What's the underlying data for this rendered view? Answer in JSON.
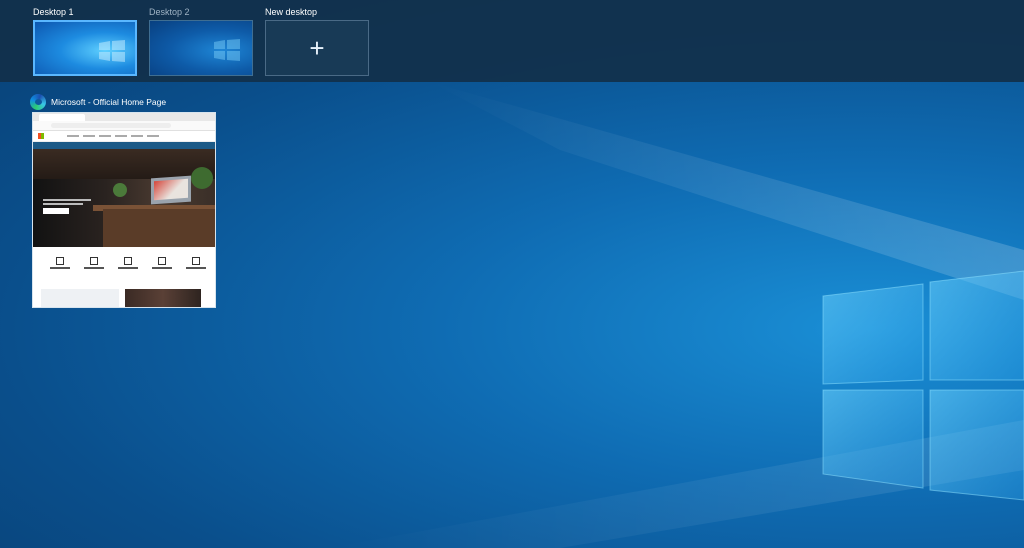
{
  "desktops": [
    {
      "label": "Desktop 1",
      "selected": true
    },
    {
      "label": "Desktop 2",
      "selected": false
    }
  ],
  "new_desktop": {
    "label": "New desktop",
    "icon": "plus-icon"
  },
  "windows": [
    {
      "title": "Microsoft - Official Home Page",
      "app_icon": "edge-icon"
    }
  ],
  "colors": {
    "desktop_bar": "#12304a",
    "selected_border": "#5ab7ff",
    "wallpaper": "#0f6cb3"
  }
}
